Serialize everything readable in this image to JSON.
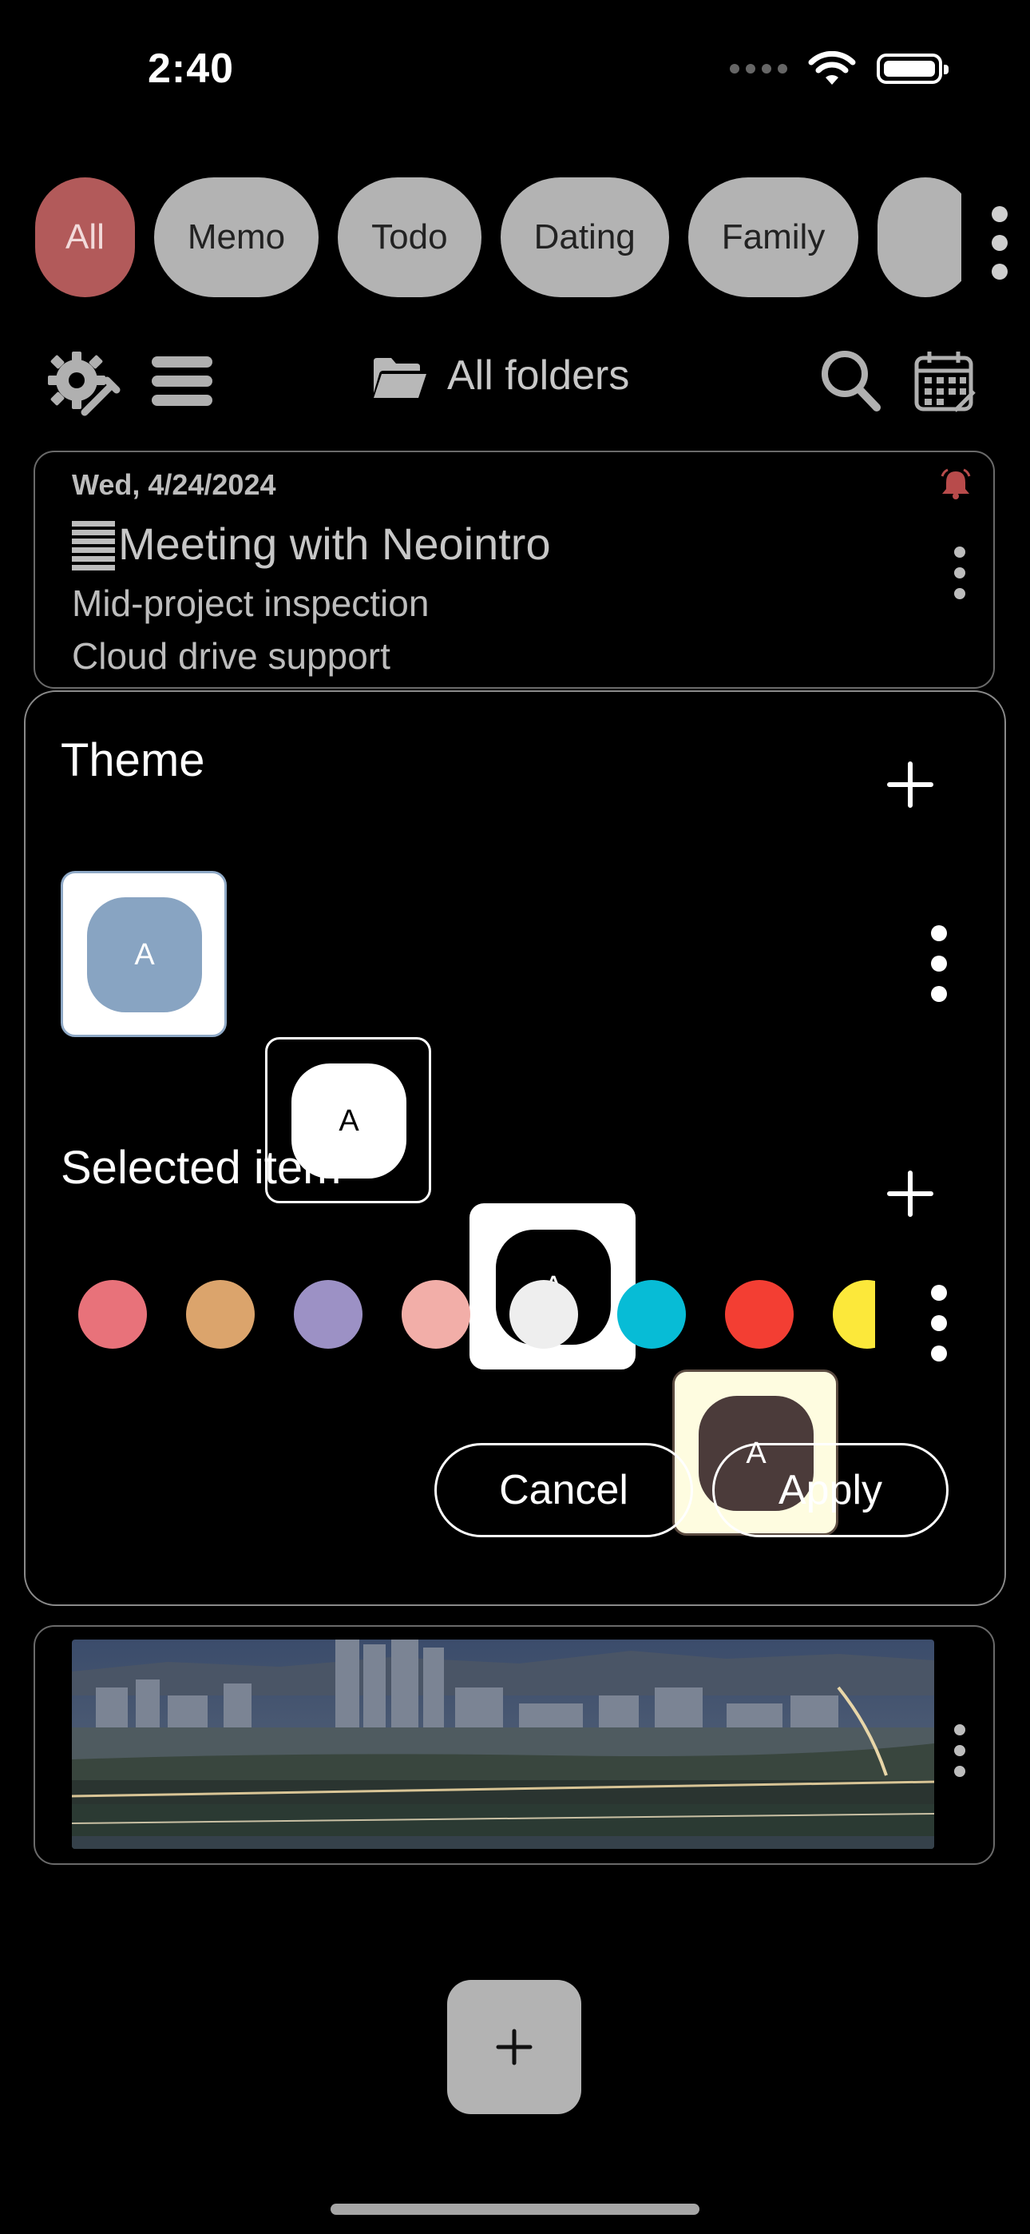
{
  "status_bar": {
    "time": "2:40"
  },
  "categories": {
    "items": [
      {
        "label": "All",
        "active": true
      },
      {
        "label": "Memo",
        "active": false
      },
      {
        "label": "Todo",
        "active": false
      },
      {
        "label": "Dating",
        "active": false
      },
      {
        "label": "Family",
        "active": false
      }
    ]
  },
  "toolbar": {
    "folder_label": "All folders"
  },
  "note": {
    "date": "Wed, 4/24/2024",
    "title": "Meeting with Neointro",
    "lines": [
      "Mid-project inspection",
      "Cloud drive support"
    ]
  },
  "theme_panel": {
    "theme_title": "Theme",
    "themes": [
      {
        "letter": "A",
        "tile_bg": "#ffffff",
        "tile_border": "#8fa9c6",
        "inner_bg": "#88a4c2",
        "inner_fg": "#ffffff",
        "selected": true
      },
      {
        "letter": "A",
        "tile_bg": "#000000",
        "tile_border": "#ffffff",
        "inner_bg": "#ffffff",
        "inner_fg": "#000000",
        "selected": false
      },
      {
        "letter": "A",
        "tile_bg": "#ffffff",
        "tile_border": "#ffffff",
        "inner_bg": "#000000",
        "inner_fg": "#ffffff",
        "selected": false
      },
      {
        "letter": "A",
        "tile_bg": "#fefce0",
        "tile_border": "#5a4a40",
        "inner_bg": "#4b3b3a",
        "inner_fg": "#ffffff",
        "selected": false
      }
    ],
    "selected_item_title": "Selected item",
    "colors": [
      "#e8727a",
      "#dba46c",
      "#9c91c5",
      "#f2aea8",
      "#eeeeee",
      "#07bcd6",
      "#f33e33",
      "#fce83a"
    ],
    "cancel_label": "Cancel",
    "apply_label": "Apply"
  },
  "colors": {
    "accent_chip": "#b25a5a",
    "chip_bg": "#b3b3b3",
    "alarm_bell": "#b84b4b"
  }
}
